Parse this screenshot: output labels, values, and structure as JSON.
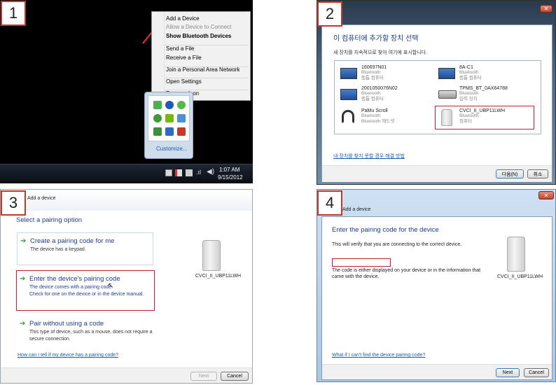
{
  "panel1": {
    "number": "1",
    "menu": [
      {
        "label": "Add a Device",
        "bold": false,
        "disabled": false
      },
      {
        "label": "Allow a Device to Connect",
        "bold": false,
        "disabled": true
      },
      {
        "label": "Show Bluetooth Devices",
        "bold": true,
        "disabled": false
      },
      {
        "label": "Send a File",
        "bold": false,
        "disabled": false
      },
      {
        "label": "Receive a File",
        "bold": false,
        "disabled": false
      },
      {
        "label": "Join a Personal Area Network",
        "bold": false,
        "disabled": false
      },
      {
        "label": "Open Settings",
        "bold": false,
        "disabled": false
      },
      {
        "label": "Remove Icon",
        "bold": false,
        "disabled": false
      }
    ],
    "customize": "Customize...",
    "time": "1:07 AM",
    "date": "9/15/2012"
  },
  "panel2": {
    "number": "2",
    "heading": "이 컴퓨터에 추가할 장치 선택",
    "subheading": "새 장치를 지속적으로 찾아 여기에 표시합니다.",
    "devices": [
      {
        "name": "160697N01",
        "line1": "Bluetooth",
        "line2": "랩톱 컴퓨터"
      },
      {
        "name": "8A-C1",
        "line1": "Bluetooth",
        "line2": "랩톱 컴퓨터"
      },
      {
        "name": "2001050076N02",
        "line1": "Bluetooth",
        "line2": "랩톱 컴퓨터"
      },
      {
        "name": "TPMS_BT_0AX64788",
        "line1": "Bluetooth",
        "line2": "입력 장치"
      },
      {
        "name": "PaMu Scroll",
        "line1": "Bluetooth",
        "line2": "Bluetooth 헤드셋"
      },
      {
        "name": "CVCI_II_UBP11LWH",
        "line1": "Bluetooth",
        "line2": "컴퓨터"
      }
    ],
    "help_link": "내 장치를 찾지 못할 경우 해결 방법",
    "next": "다음(N)",
    "cancel": "취소"
  },
  "panel3": {
    "number": "3",
    "title": "Add a device",
    "heading": "Select a pairing option",
    "options": [
      {
        "title": "Create a pairing code for me",
        "desc1": "The device has a keypad.",
        "desc2": ""
      },
      {
        "title": "Enter the device's pairing code",
        "desc1": "The device comes with a pairing code.",
        "desc2": "Check for one on the device or in the device manual."
      },
      {
        "title": "Pair without using a code",
        "desc1": "This type of device, such as a mouse, does not require a",
        "desc2": "secure connection."
      }
    ],
    "device_name": "CVCI_II_UBP11LWH",
    "help_link": "How can I tell if my device has a pairing code?",
    "next": "Next",
    "cancel": "Cancel"
  },
  "panel4": {
    "number": "4",
    "title": "Add a device",
    "heading": "Enter the pairing code for the device",
    "verify": "This will verify that you are connecting to the correct device.",
    "code_value": "",
    "note1": "The code is either displayed on your device or in the information that",
    "note2": "came with the device.",
    "device_name": "CVCI_II_UBP11LWH",
    "help_link": "What if I can't find the device pairing code?",
    "next": "Next",
    "cancel": "Cancel"
  }
}
